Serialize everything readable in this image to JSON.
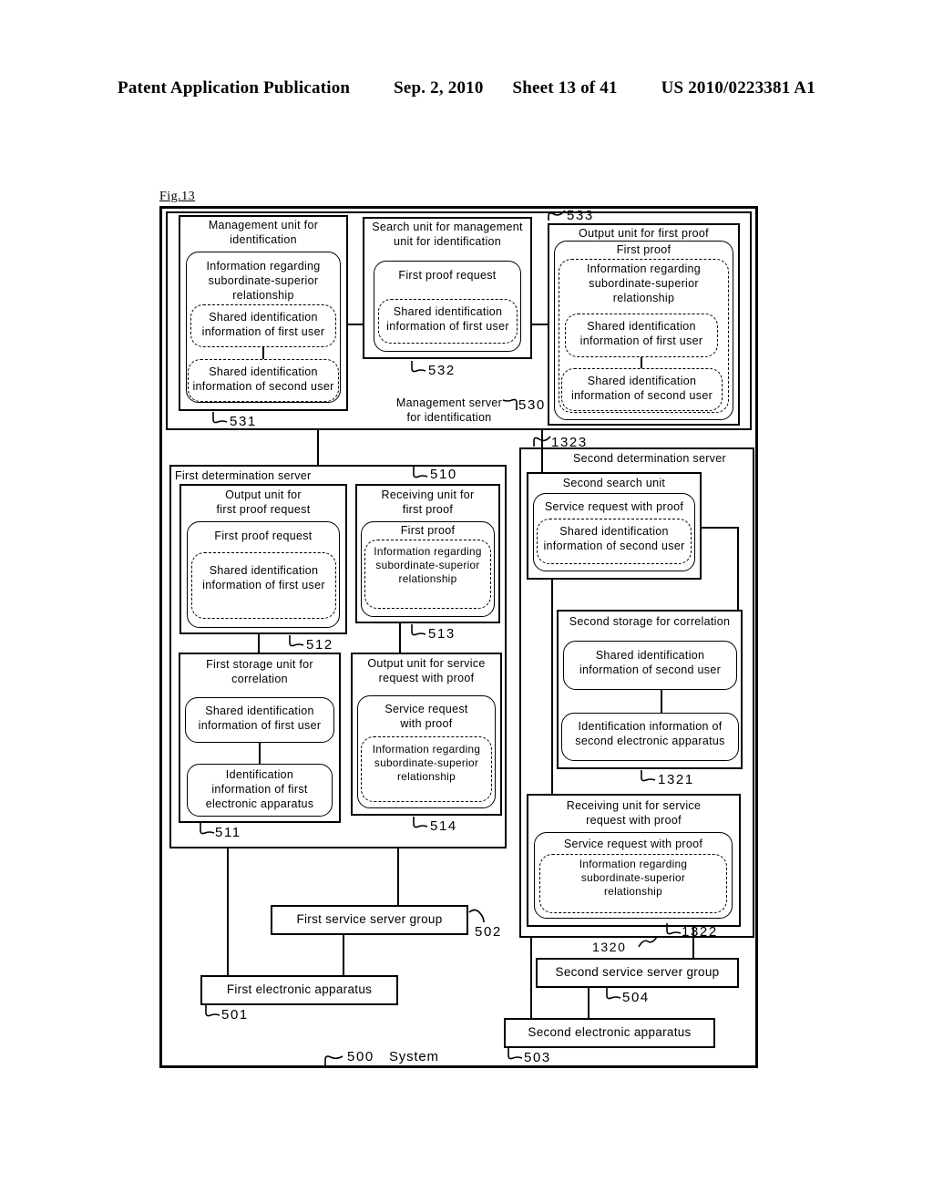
{
  "header": {
    "publication": "Patent Application Publication",
    "date": "Sep. 2, 2010",
    "sheet": "Sheet 13 of 41",
    "number": "US 2010/0223381 A1"
  },
  "figure": {
    "label": "Fig.13",
    "system_ref": "500",
    "system_label": "System"
  },
  "management_server": {
    "title": "Management server\nfor identification",
    "ref": "530",
    "management_unit": {
      "title": "Management unit for\nidentification",
      "ref": "531",
      "info_relationship": "Information regarding\nsubordinate-superior\nrelationship",
      "shared_first": "Shared  identification\ninformation of first user",
      "shared_second": "Shared  identification\ninformation of second user"
    },
    "search_unit": {
      "title": "Search unit for management\nunit for identification",
      "ref": "532",
      "first_proof_request": "First proof request",
      "shared_first": "Shared  identification\ninformation of first user"
    },
    "output_unit": {
      "title": "Output unit for first proof",
      "ref": "533",
      "first_proof": "First proof",
      "info_relationship": "Information regarding\nsubordinate-superior\nrelationship",
      "shared_first": "Shared  identification\ninformation of first user",
      "shared_second": "Shared  identification\ninformation of second user"
    }
  },
  "first_determination_server": {
    "title": "First determination server",
    "ref": "510",
    "output_unit_request": {
      "title": "Output unit for\nfirst proof request",
      "ref": "512",
      "first_proof_request": "First proof request",
      "shared_first": "Shared  identification\ninformation of first user"
    },
    "receiving_unit": {
      "title": "Receiving unit for\nfirst proof",
      "ref": "513",
      "first_proof": "First proof",
      "info_relationship": "Information regarding\nsubordinate-superior\nrelationship"
    },
    "first_storage": {
      "title": "First storage unit for\ncorrelation",
      "ref": "511",
      "shared_first": "Shared  identification\ninformation of first user",
      "identification_info": "Identification\ninformation of first\nelectronic apparatus"
    },
    "output_unit_service": {
      "title": "Output unit for service\nrequest with proof",
      "ref": "514",
      "service_request": "Service request\nwith proof",
      "info_relationship": "Information regarding\nsubordinate-superior\nrelationship"
    }
  },
  "second_determination_server": {
    "title": "Second determination server",
    "ref": "1323",
    "second_search_unit": {
      "title": "Second search unit",
      "service_request": "Service request with proof",
      "shared_second": "Shared  identification\ninformation of second user"
    },
    "second_storage": {
      "title": "Second storage for correlation",
      "ref": "1321",
      "shared_second": "Shared  identification\ninformation of second user",
      "identification_info": "Identification information of\nsecond electronic apparatus"
    },
    "receiving_unit": {
      "title": "Receiving unit for service\nrequest with proof",
      "ref": "1322",
      "service_request": "Service request with proof",
      "info_relationship": "Information regarding\nsubordinate-superior\nrelationship"
    },
    "group_ref": "1320"
  },
  "bottom": {
    "first_service_server_group": "First service server group",
    "first_service_server_group_ref": "502",
    "first_electronic_apparatus": "First electronic apparatus",
    "first_electronic_apparatus_ref": "501",
    "second_service_server_group": "Second service server group",
    "second_service_server_group_ref": "504",
    "second_electronic_apparatus": "Second electronic apparatus",
    "second_electronic_apparatus_ref": "503"
  },
  "colors": {
    "ink": "#000000",
    "paper": "#ffffff"
  }
}
